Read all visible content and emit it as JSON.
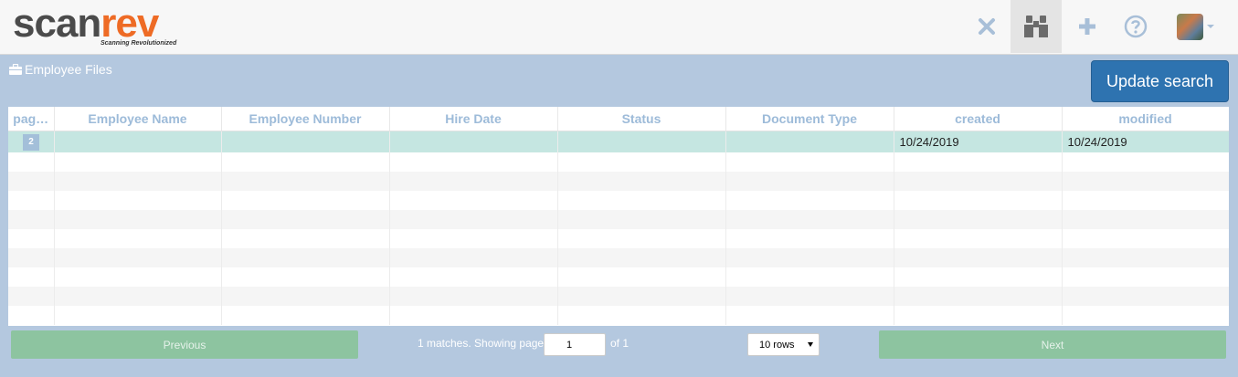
{
  "app": {
    "logo_main_a": "scan",
    "logo_main_b": "rev",
    "logo_tagline": "Scanning Revolutionized"
  },
  "nav": {
    "icons": [
      "close-icon",
      "binoculars-icon",
      "plus-icon",
      "help-icon",
      "avatar"
    ]
  },
  "breadcrumb": {
    "label": "Employee Files"
  },
  "toolbar": {
    "update_label": "Update search"
  },
  "table": {
    "columns": [
      "pag…",
      "Employee Name",
      "Employee Number",
      "Hire Date",
      "Status",
      "Document Type",
      "created",
      "modified"
    ],
    "rows": [
      {
        "pages": "2",
        "employee_name": "",
        "employee_number": "",
        "hire_date": "",
        "status": "",
        "document_type": "",
        "created": "10/24/2019",
        "modified": "10/24/2019"
      }
    ]
  },
  "pagination": {
    "prev_label": "Previous",
    "info": "1 matches. Showing page",
    "page_value": "1",
    "of_text": "of 1",
    "rows_label": "10 rows",
    "next_label": "Next"
  },
  "colors": {
    "accent": "#2e73b0",
    "brand_orange": "#ee6b25",
    "background": "#b4c8df",
    "selected_row": "#c5e6e1",
    "pager_button": "#8dc4a0"
  }
}
